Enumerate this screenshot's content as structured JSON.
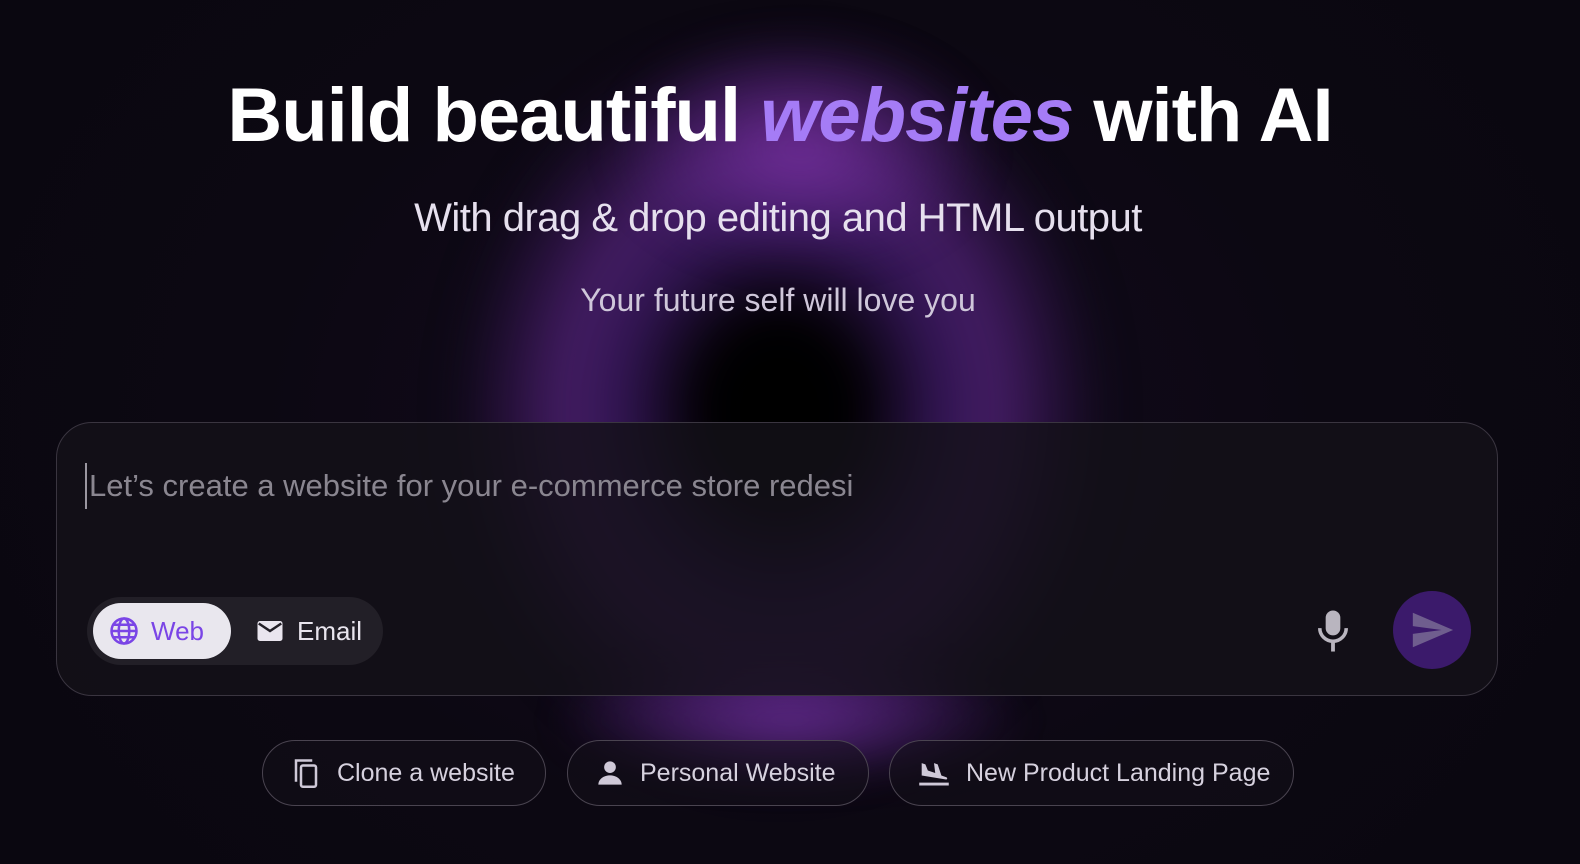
{
  "hero": {
    "title_before": "Build beautiful ",
    "title_accent": "websites",
    "title_after": " with AI",
    "subtitle": "With drag & drop editing and HTML output",
    "tagline": "Your future self will love you"
  },
  "prompt": {
    "placeholder": "Let’s create a website for your e-commerce store redesi",
    "value": ""
  },
  "modes": [
    {
      "label": "Web",
      "icon": "globe-icon",
      "selected": true
    },
    {
      "label": "Email",
      "icon": "mail-icon",
      "selected": false
    }
  ],
  "actions": {
    "mic_icon": "microphone-icon",
    "send_icon": "send-icon"
  },
  "suggestions": [
    {
      "label": "Clone a website",
      "icon": "copy-icon"
    },
    {
      "label": "Personal Website",
      "icon": "person-icon"
    },
    {
      "label": "New Product Landing Page",
      "icon": "airplane-landing-icon"
    }
  ],
  "colors": {
    "accent": "#a57cf6",
    "web_selected_text": "#7a45e6",
    "send_button_bg": "#3b1a6b",
    "background": "#0c0812"
  }
}
